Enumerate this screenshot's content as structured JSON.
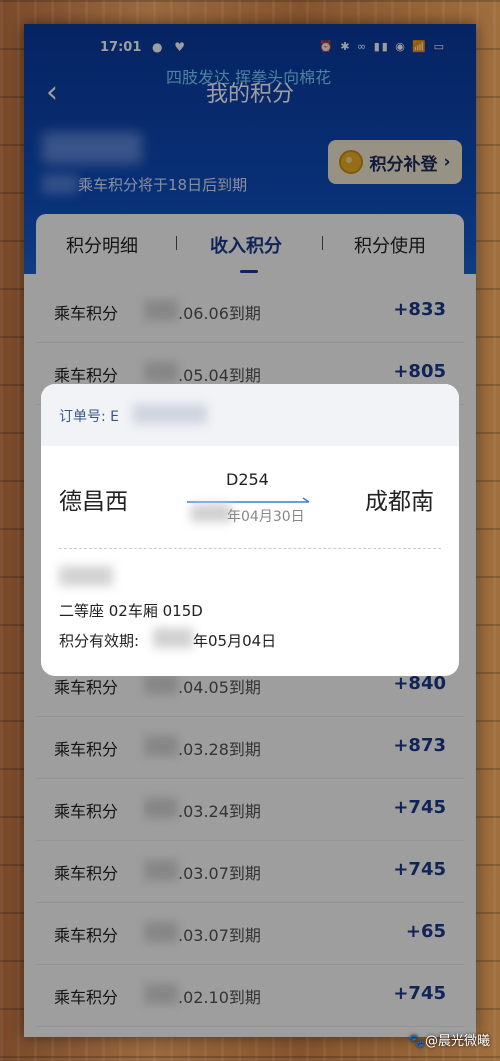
{
  "status_bar": {
    "time": "17:01",
    "left_icons": "● ♥",
    "right_icons": "⏰ ✱ ∞ ▮▮ ◉ 📶 ▭"
  },
  "overlay_caption": "四肢发达 挥拳头向棉花",
  "header": {
    "title": "我的积分",
    "back_icon": "‹",
    "expire_note": "乘车积分将于18日后到期",
    "makeup_label": "积分补登",
    "makeup_chevron": "›"
  },
  "tabs": [
    {
      "label": "积分明细"
    },
    {
      "label": "收入积分"
    },
    {
      "label": "积分使用"
    }
  ],
  "rows": [
    {
      "label": "乘车积分",
      "date": ".06.06到期",
      "value": "+833"
    },
    {
      "label": "乘车积分",
      "date": ".05.04到期",
      "value": "+805"
    },
    {
      "label": "乘车积分",
      "date": ".04.05到期",
      "value": "+840"
    },
    {
      "label": "乘车积分",
      "date": ".03.28到期",
      "value": "+873"
    },
    {
      "label": "乘车积分",
      "date": ".03.24到期",
      "value": "+745"
    },
    {
      "label": "乘车积分",
      "date": ".03.07到期",
      "value": "+745"
    },
    {
      "label": "乘车积分",
      "date": ".03.07到期",
      "value": "+65"
    },
    {
      "label": "乘车积分",
      "date": ".02.10到期",
      "value": "+745"
    }
  ],
  "dialog": {
    "order_label": "订单号: E",
    "from_station": "德昌西",
    "to_station": "成都南",
    "train_no": "D254",
    "date_text": "年04月30日",
    "seat": "二等座  02车厢  015D",
    "valid_label": "积分有效期:",
    "valid_date": "年05月04日"
  },
  "watermark": "🐾@晨光微曦"
}
